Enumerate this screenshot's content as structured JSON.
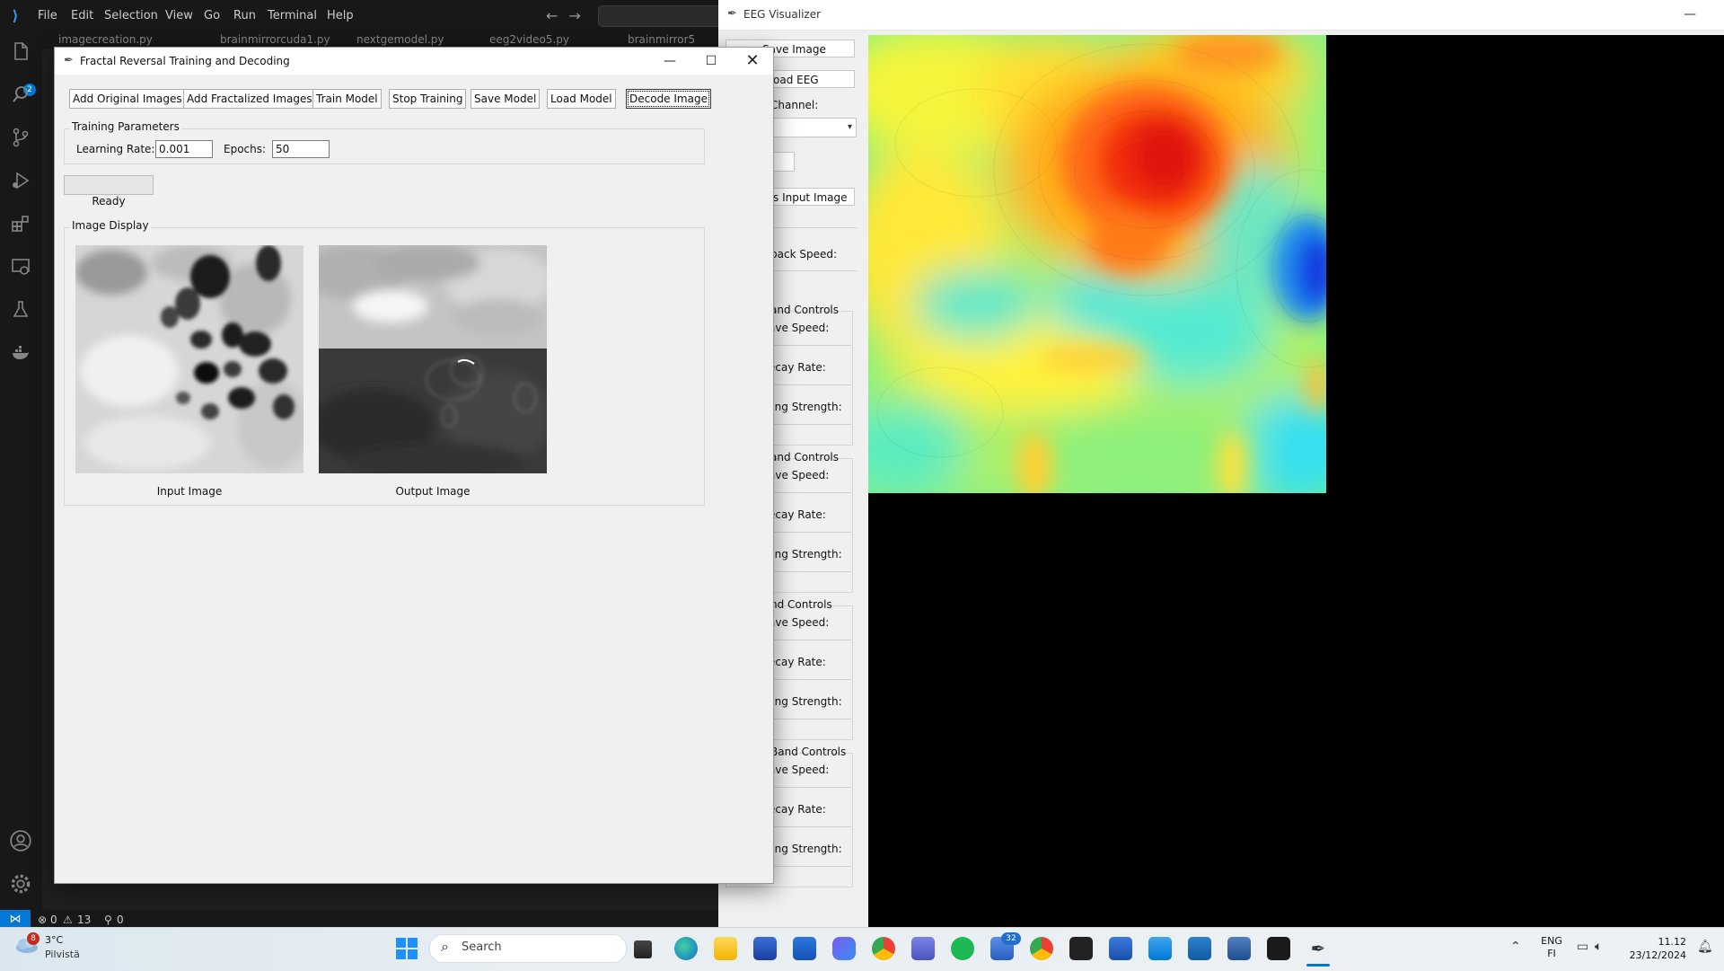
{
  "vscode": {
    "menu": [
      "File",
      "Edit",
      "Selection",
      "View",
      "Go",
      "Run",
      "Terminal",
      "Help"
    ],
    "tabs": [
      "imagecreation.py",
      "brainmirrorcuda1.py",
      "nextgemodel.py",
      "eeg2video5.py",
      "brainmirror5"
    ],
    "activity_badge": "2",
    "status": {
      "errors": "0",
      "warnings": "13",
      "ports": "0"
    }
  },
  "eeg": {
    "title": "EEG Visualizer",
    "save_image": "Save Image",
    "load_eeg": "oad EEG",
    "channel_label": "Channel:",
    "input_image_btn": "s Input Image",
    "playback_speed": "back Speed:",
    "bands": [
      {
        "title": "and Controls",
        "wave_speed": "ave Speed:",
        "decay": "ecay Rate:",
        "coupling": "ling Strength:"
      },
      {
        "title": "and Controls",
        "wave_speed": "ave Speed:",
        "decay": "ecay Rate:",
        "coupling": "ling Strength:"
      },
      {
        "title": "nd Controls",
        "wave_speed": "ave Speed:",
        "decay": "ecay Rate:",
        "coupling": "ling Strength:"
      },
      {
        "title": "Band Controls",
        "wave_speed": "ave Speed:",
        "decay": "ecay Rate:",
        "coupling": "ling Strength:"
      }
    ]
  },
  "main": {
    "title": "Fractal Reversal Training and Decoding",
    "buttons": {
      "add_original": "Add Original Images",
      "add_fractalized": "Add Fractalized Images",
      "train": "Train Model",
      "stop": "Stop Training",
      "save": "Save Model",
      "load": "Load Model",
      "decode": "Decode Image"
    },
    "params": {
      "frame_label": "Training Parameters",
      "lr_label": "Learning Rate:",
      "lr_value": "0.001",
      "epochs_label": "Epochs:",
      "epochs_value": "50"
    },
    "progress": 0,
    "status": "Ready",
    "display": {
      "frame_label": "Image Display",
      "input_caption": "Input Image",
      "output_caption": "Output Image"
    }
  },
  "taskbar": {
    "weather_badge": "8",
    "weather_temp": "3°C",
    "weather_desc": "Pilvistä",
    "search_label": "Search",
    "teams_badge": "32",
    "lang_1": "ENG",
    "lang_2": "FI",
    "time": "11.12",
    "date": "23/12/2024"
  },
  "colors": {
    "vscode_bg": "#181818",
    "accent_blue": "#0078d4",
    "tk_bg": "#f0f0f0"
  }
}
